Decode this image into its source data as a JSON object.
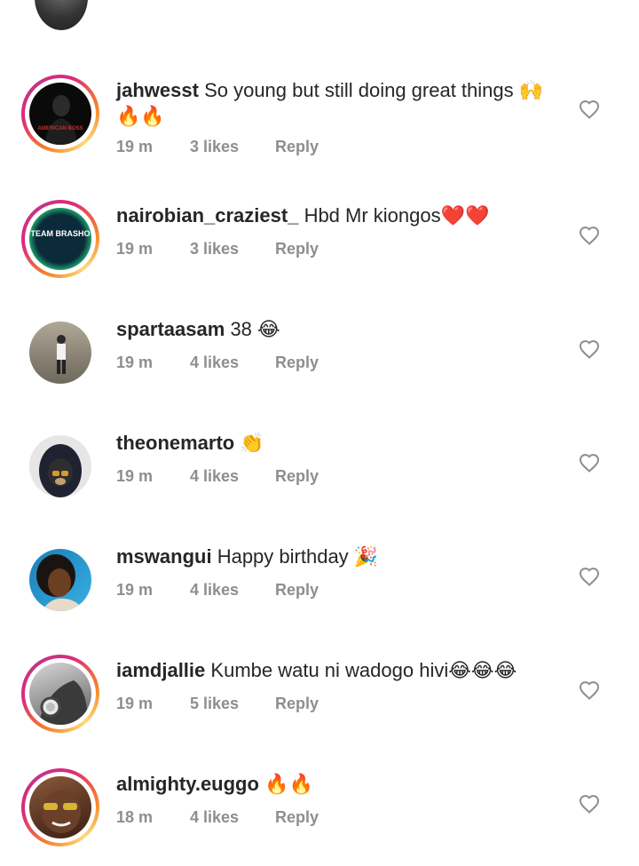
{
  "comments": [
    {
      "username": "jahwesst",
      "text": "So young but still doing great things 🙌🔥🔥",
      "time": "19 m",
      "likes": "3 likes",
      "reply": "Reply",
      "avatar_caption": "AMERICAN BOSS",
      "story_ring": true
    },
    {
      "username": "nairobian_craziest_",
      "text": "Hbd Mr kiongos❤️❤️",
      "time": "19 m",
      "likes": "3 likes",
      "reply": "Reply",
      "avatar_caption": "TEAM BRASHO",
      "story_ring": true
    },
    {
      "username": "spartaasam",
      "text": "38 😂",
      "time": "19 m",
      "likes": "4 likes",
      "reply": "Reply",
      "story_ring": false
    },
    {
      "username": "theonemarto",
      "text": "👏",
      "time": "19 m",
      "likes": "4 likes",
      "reply": "Reply",
      "story_ring": false
    },
    {
      "username": "mswangui",
      "text": "Happy birthday 🎉",
      "time": "19 m",
      "likes": "4 likes",
      "reply": "Reply",
      "story_ring": false
    },
    {
      "username": "iamdjallie",
      "text": "Kumbe watu ni wadogo hivi😂😂😂",
      "time": "19 m",
      "likes": "5 likes",
      "reply": "Reply",
      "story_ring": true
    },
    {
      "username": "almighty.euggo",
      "text": "🔥🔥",
      "time": "18 m",
      "likes": "4 likes",
      "reply": "Reply",
      "story_ring": true
    }
  ],
  "icons": {
    "like": "heart-outline-icon"
  },
  "colors": {
    "username": "#262626",
    "meta": "#8e8e8e",
    "heart": "#8e8e8e",
    "ring_start": "#f58529",
    "ring_end": "#dd2a7b"
  }
}
